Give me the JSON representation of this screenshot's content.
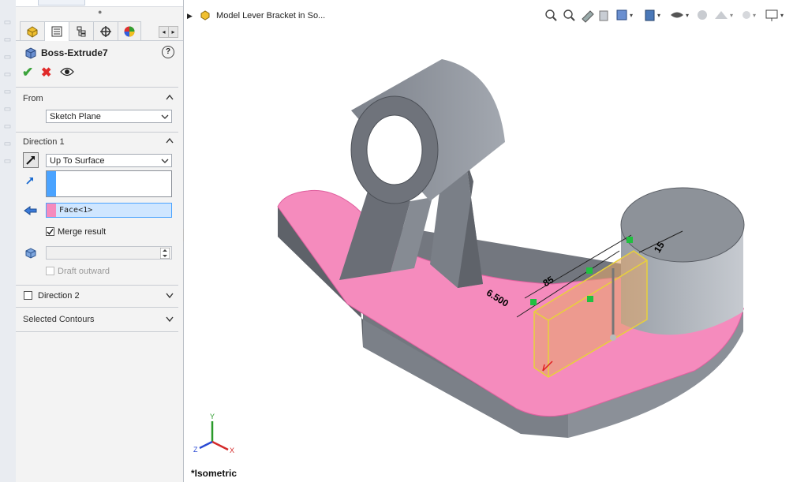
{
  "feature": {
    "title": "Boss-Extrude7"
  },
  "sections": {
    "from": {
      "title": "From",
      "value": "Sketch Plane"
    },
    "direction1": {
      "title": "Direction 1",
      "end_condition": "Up To Surface",
      "face_selection": "Face<1>",
      "merge_result": "Merge result",
      "merge_checked": true,
      "draft_outward": "Draft outward"
    },
    "direction2": {
      "title": "Direction 2",
      "checked": false
    },
    "selected_contours": {
      "title": "Selected Contours"
    }
  },
  "viewport": {
    "breadcrumb": "Model Lever Bracket in So...",
    "view_name": "*Isometric",
    "dimensions": {
      "length": "85",
      "offset": "6.500",
      "width": "15"
    },
    "triad": {
      "x": "X",
      "y": "Y",
      "z": "Z"
    }
  },
  "colors": {
    "accent_blue": "#4aa3ff",
    "face_pink": "#f58bbd",
    "ok_green": "#3ba33b",
    "cancel_red": "#e02a2a",
    "body_gray": "#8e939c",
    "preview_yellow": "#e8d13a"
  },
  "icons": [
    "feature-manager-icon",
    "property-manager-icon",
    "config-manager-icon",
    "dimxpert-icon",
    "display-manager-icon",
    "help-icon",
    "ok-check-icon",
    "cancel-x-icon",
    "preview-eye-icon",
    "reverse-direction-icon",
    "direction-arrow-icon",
    "face-select-icon",
    "offset-icon",
    "zoom-to-fit-icon",
    "zoom-area-icon",
    "previous-view-icon",
    "section-view-icon",
    "view-orientation-icon",
    "display-style-icon",
    "hide-show-icon",
    "edit-appearance-icon",
    "scene-icon",
    "view-settings-icon",
    "monitor-icon"
  ]
}
